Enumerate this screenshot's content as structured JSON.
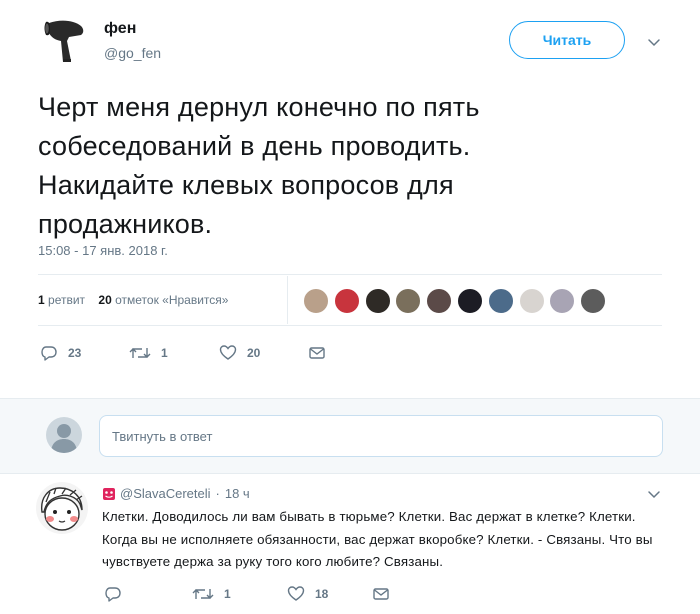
{
  "tweet": {
    "author_name": "фен",
    "author_handle": "@go_fen",
    "follow_label": "Читать",
    "text": "Черт меня дернул конечно по пять\nсобеседований в день проводить.\nНакидайте клевых вопросов для\nпродажников.",
    "timestamp": "15:08 - 17 янв. 2018 г.",
    "retweets_count": "1",
    "retweets_label": "ретвит",
    "likes_count": "20",
    "likes_label": "отметок «Нравится»",
    "replies": "23",
    "retweets": "1",
    "likes": "20",
    "liker_colors": [
      "#b9a08a",
      "#c8343d",
      "#2e2a26",
      "#7a6f5c",
      "#5b4a48",
      "#1c1c24",
      "#4c6b8a",
      "#d8d4d0",
      "#a8a4b4",
      "#5c5c5c"
    ]
  },
  "reply_bar": {
    "placeholder": "Твитнуть в ответ"
  },
  "reply": {
    "handle": "@SlavaCereteli",
    "separator": "·",
    "time": "18 ч",
    "text": "Клетки. Доводилось ли вам бывать в тюрьме? Клетки. Вас держат в клетке? Клетки. Когда вы не исполняете обязанности, вас держат вкоробке? Клетки. - Связаны. Что вы чувствуете держа за руку того кого любите? Связаны.",
    "retweets": "1",
    "likes": "18"
  },
  "colors": {
    "accent": "#1da1f2",
    "muted": "#657786",
    "text": "#14171a",
    "border": "#e6ecf0",
    "bar_bg": "#f5f8fa"
  },
  "icons": [
    "hair-dryer-avatar-icon",
    "chevron-down-icon",
    "reply-icon",
    "retweet-icon",
    "like-icon",
    "direct-message-icon",
    "user-placeholder-icon",
    "emoji-badge-icon"
  ]
}
